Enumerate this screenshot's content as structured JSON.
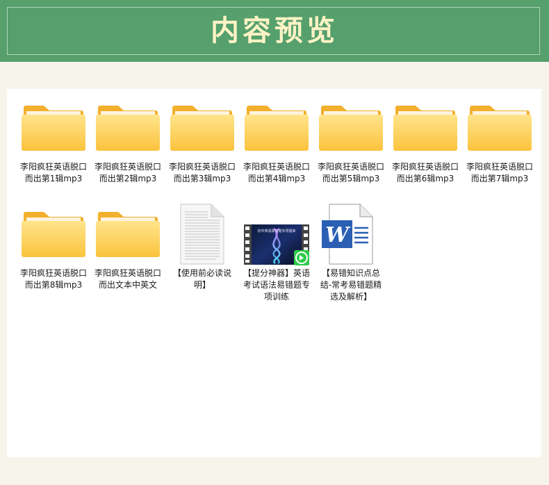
{
  "header": {
    "title": "内容预览"
  },
  "files": [
    {
      "name": "李阳疯狂英语脱口而出第1辑mp3",
      "type": "folder"
    },
    {
      "name": "李阳疯狂英语脱口而出第2辑mp3",
      "type": "folder"
    },
    {
      "name": "李阳疯狂英语脱口而出第3辑mp3",
      "type": "folder"
    },
    {
      "name": "李阳疯狂英语脱口而出第4辑mp3",
      "type": "folder"
    },
    {
      "name": "李阳疯狂英语脱口而出第5辑mp3",
      "type": "folder"
    },
    {
      "name": "李阳疯狂英语脱口而出第6辑mp3",
      "type": "folder"
    },
    {
      "name": "李阳疯狂英语脱口而出第7辑mp3",
      "type": "folder"
    },
    {
      "name": "李阳疯狂英语脱口而出第8辑mp3",
      "type": "folder"
    },
    {
      "name": "李阳疯狂英语脱口而出文本中英文",
      "type": "folder"
    },
    {
      "name": "【使用前必读说明】",
      "type": "text-document"
    },
    {
      "name": "【提分神器】英语考试语法易错题专项训练",
      "type": "video",
      "thumbnail_caption": "初中英语易错题专项题库"
    },
    {
      "name": "【易错知识点总结-常考易错题精选及解析】",
      "type": "word-document",
      "icon_letter": "W"
    }
  ],
  "colors": {
    "header_bg": "#55a06c",
    "title": "#fff3c6",
    "folder": "#fbc94a",
    "word_blue": "#2b5fb3"
  }
}
